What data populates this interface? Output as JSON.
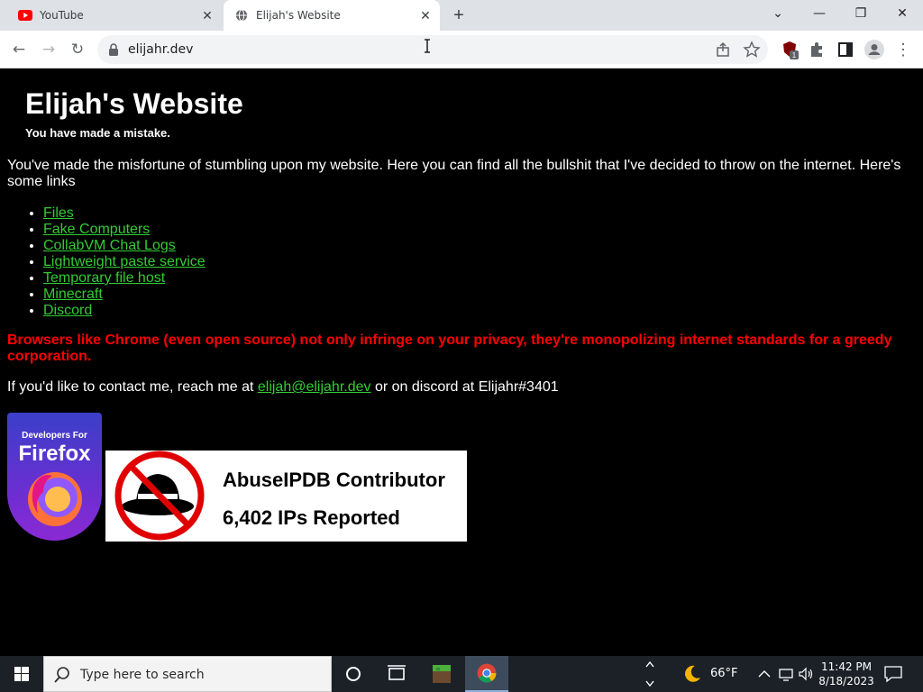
{
  "browser": {
    "tabs": [
      {
        "title": "YouTube",
        "close": "✕"
      },
      {
        "title": "Elijah's Website",
        "close": "✕"
      }
    ],
    "new_tab": "+",
    "window_controls": {
      "chevron": "⌄",
      "minimize": "—",
      "restore": "❐",
      "close": "✕"
    },
    "nav": {
      "back": "←",
      "forward": "→",
      "reload": "↻"
    },
    "url": "elijahr.dev",
    "extension_badge": "1",
    "menu": "⋮"
  },
  "page": {
    "title": "Elijah's Website",
    "subtitle": "You have made a mistake.",
    "intro": "You've made the misfortune of stumbling upon my website. Here you can find all the bullshit that I've decided to throw on the internet. Here's some links",
    "links": [
      "Files",
      "Fake Computers",
      "CollabVM Chat Logs",
      "Lightweight paste service",
      "Temporary file host",
      "Minecraft",
      "Discord"
    ],
    "warning": "Browsers like Chrome (even open source) not only infringe on your privacy, they're monopolizing internet standards for a greedy corporation.",
    "contact": {
      "prefix": "If you'd like to contact me, reach me at ",
      "email": "elijah@elijahr.dev",
      "suffix": " or on discord at Elijahr#3401"
    },
    "firefox_badge": {
      "line1": "Developers For",
      "line2": "Firefox"
    },
    "abuseipdb_badge": {
      "line1": "AbuseIPDB Contributor",
      "line2": "6,402 IPs Reported"
    }
  },
  "taskbar": {
    "search_placeholder": "Type here to search",
    "weather_temp": "66°F",
    "time": "11:42 PM",
    "date": "8/18/2023"
  },
  "colors": {
    "link": "#32cd32",
    "warning": "#ff0000",
    "page_bg": "#000000"
  }
}
